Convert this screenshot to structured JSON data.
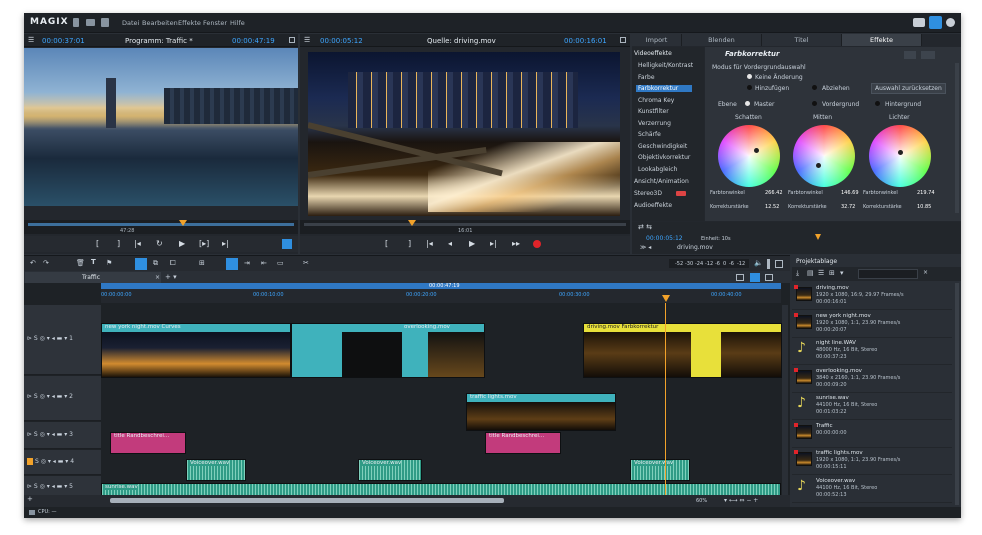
{
  "menubar": {
    "logo": "MAGIX",
    "items": [
      "Datei",
      "Bearbeiten",
      "Effekte",
      "Fenster",
      "Hilfe"
    ]
  },
  "program_monitor": {
    "time_left": "00:00:37:01",
    "title": "Programm: Traffic *",
    "time_right": "00:00:47:19",
    "seek_label": "47:28"
  },
  "source_monitor": {
    "time_left": "00:00:05:12",
    "title": "Quelle: driving.mov",
    "time_right": "00:00:16:01",
    "seek_label": "16:01"
  },
  "right_panel": {
    "tabs": [
      "Import",
      "Blenden",
      "Titel",
      "Effekte"
    ],
    "category": "Videoeffekte",
    "effects": [
      "Helligkeit/Kontrast",
      "Farbe",
      "Farbkorrektur",
      "Chroma Key",
      "Kunstfilter",
      "Verzerrung",
      "Schärfe",
      "Geschwindigkeit",
      "Objektivkorrektur",
      "Lookabgleich"
    ],
    "groups": [
      "Ansicht/Animation",
      "Stereo3D",
      "Audioeffekte"
    ],
    "selected_effect": "Farbkorrektur",
    "fk": {
      "title": "Farbkorrektur",
      "mode_label": "Modus für Vordergrundauswahl",
      "opt1": "Keine Änderung",
      "opt2": "Hinzufügen",
      "opt3": "Abziehen",
      "reset": "Auswahl zurücksetzen",
      "ebene": "Ebene",
      "master": "Master",
      "vordergrund": "Vordergrund",
      "hintergrund": "Hintergrund",
      "wheels": [
        {
          "name": "Schatten",
          "angle_label": "Farbtonwinkel",
          "angle": "266.42",
          "strength_label": "Korrekturstärke",
          "strength": "12.52"
        },
        {
          "name": "Mitten",
          "angle_label": "Farbtonwinkel",
          "angle": "146.69",
          "strength_label": "Korrekturstärke",
          "strength": "32.72"
        },
        {
          "name": "Lichter",
          "angle_label": "Farbtonwinkel",
          "angle": "219.74",
          "strength_label": "Korrekturstärke",
          "strength": "10.85"
        }
      ]
    },
    "kf_time": "00:00:05:12",
    "kf_unit": "Einheit: 10s",
    "kf_clip": "driving.mov"
  },
  "timeline": {
    "tab_name": "Traffic",
    "position": "00:00:47:19",
    "ruler": [
      "00:00:00:00",
      "00:00:10:00",
      "00:00:20:00",
      "00:00:30:00",
      "00:00:40:00"
    ],
    "meter": [
      "-52",
      "-30",
      "-24",
      "-12",
      "-6",
      "0",
      "-6",
      "-12"
    ],
    "zoom": "60%",
    "status": "CPU: —",
    "clips": {
      "c1": "new york night.mov  Curves",
      "c2": "overlooking.mov",
      "c3": "driving.mov  Farbkorrektur",
      "c4": "traffic lights.mov",
      "t1": "title  Randbeschrei…",
      "t2": "title  Randbeschrei…",
      "v1": "Voiceover.wav",
      "v2": "Voiceover.wav",
      "v3": "Voiceover.wav",
      "s1": "sunrise.wav"
    }
  },
  "project": {
    "title": "Projektablage",
    "items": [
      {
        "name": "driving.mov",
        "line1": "1920 x 1080, 16:9, 29.97 Frames/s",
        "line2": "00:00:16:01",
        "kind": "video"
      },
      {
        "name": "new york night.mov",
        "line1": "1920 x 1080, 1:1, 23.90 Frames/s",
        "line2": "00:00:20:07",
        "kind": "video"
      },
      {
        "name": "night line.WAV",
        "line1": "48000 Hz, 16 Bit, Stereo",
        "line2": "00:00:37:23",
        "kind": "audio"
      },
      {
        "name": "overlooking.mov",
        "line1": "3840 x 2160, 1:1, 23.90 Frames/s",
        "line2": "00:00:09:20",
        "kind": "video"
      },
      {
        "name": "sunrise.wav",
        "line1": "44100 Hz, 16 Bit, Stereo",
        "line2": "00:01:03:22",
        "kind": "audio"
      },
      {
        "name": "Traffic",
        "line1": "00:00:00:00",
        "line2": "",
        "kind": "video"
      },
      {
        "name": "traffic lights.mov",
        "line1": "1920 x 1080, 1:1, 23.90 Frames/s",
        "line2": "00:00:15:11",
        "kind": "video"
      },
      {
        "name": "Voiceover.wav",
        "line1": "44100 Hz, 16 Bit, Stereo",
        "line2": "00:00:52:13",
        "kind": "audio"
      }
    ]
  }
}
